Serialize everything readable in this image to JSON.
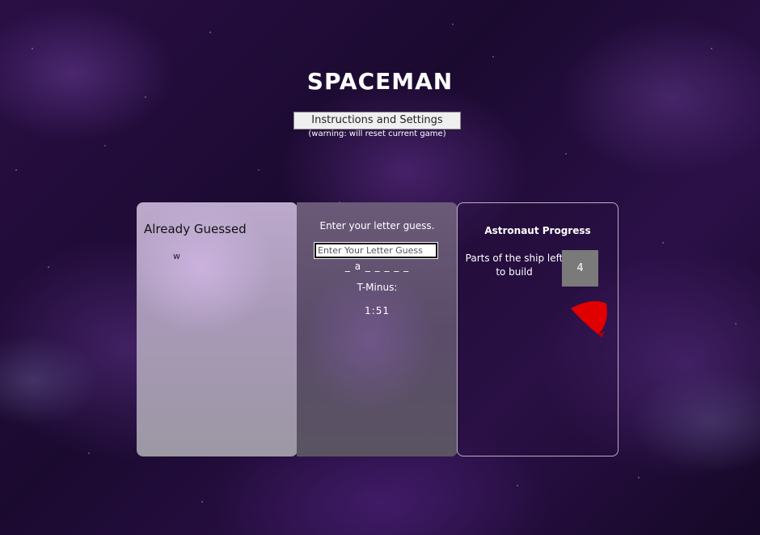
{
  "header": {
    "title": "SPACEMAN",
    "settings_button": "Instructions and Settings",
    "warning": "(warning: will reset current game)"
  },
  "guessed_panel": {
    "heading": "Already Guessed",
    "letters": "w"
  },
  "guess_panel": {
    "prompt": "Enter your letter guess.",
    "input_placeholder": "Enter Your Letter Guess",
    "input_value": "",
    "word_display": "_ a _ _ _ _ _",
    "tminus_label": "T-Minus:",
    "timer": "1:51"
  },
  "progress_panel": {
    "heading": "Astronaut Progress",
    "parts_label": "Parts of the ship left to build",
    "parts_left": "4",
    "ship_icon": "rocket-piece-icon",
    "ship_color": "#e00000"
  },
  "colors": {
    "background": "#1a0b2e",
    "accent": "#ffffff",
    "counter_box": "#7a7a7a"
  }
}
